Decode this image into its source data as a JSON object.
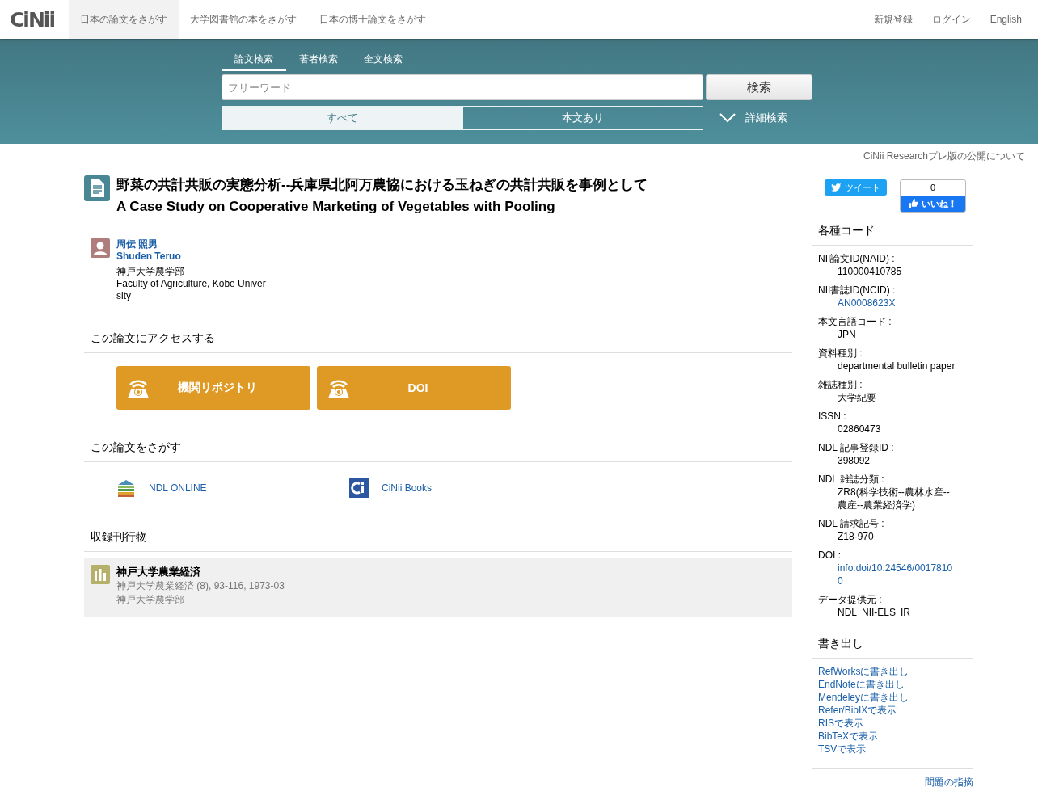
{
  "logo": "CiNii",
  "nav": [
    {
      "label": "日本の論文をさがす",
      "selected": true
    },
    {
      "label": "大学図書館の本をさがす",
      "selected": false
    },
    {
      "label": "日本の博士論文をさがす",
      "selected": false
    }
  ],
  "account_links": [
    "新規登録",
    "ログイン",
    "English"
  ],
  "search": {
    "tabs": [
      {
        "label": "論文検索",
        "selected": true
      },
      {
        "label": "著者検索",
        "selected": false
      },
      {
        "label": "全文検索",
        "selected": false
      }
    ],
    "placeholder": "フリーワード",
    "button": "検索",
    "filters": [
      {
        "label": "すべて",
        "selected": true
      },
      {
        "label": "本文あり",
        "selected": false
      }
    ],
    "advanced": "詳細検索"
  },
  "notice_link": "CiNii Researchプレ版の公開について",
  "article": {
    "title_ja": "野菜の共計共販の実態分析--兵庫県北阿万農協における玉ねぎの共計共販を事例として",
    "title_en": "A Case Study on Cooperative Marketing of Vegetables with Pooling",
    "authors": [
      {
        "name_ja": "周伝 照男",
        "name_en": "Shuden Teruo",
        "affiliation_ja": "神戸大学農学部",
        "affiliation_en": "Faculty of Agriculture, Kobe University"
      }
    ]
  },
  "access": {
    "heading": "この論文にアクセスする",
    "buttons": [
      "機関リポジトリ",
      "DOI"
    ]
  },
  "find": {
    "heading": "この論文をさがす",
    "links": [
      {
        "label": "NDL ONLINE",
        "kind": "ndl"
      },
      {
        "label": "CiNii Books",
        "kind": "cinii"
      }
    ]
  },
  "journal": {
    "heading": "収録刊行物",
    "title": "神戸大学農業経済",
    "citation": "神戸大学農業経済 (8), 93-116, 1973-03",
    "publisher": "神戸大学農学部"
  },
  "social": {
    "tweet": "ツイート",
    "like_count": "0",
    "like": "いいね！"
  },
  "codes": {
    "heading": "各種コード",
    "items": [
      {
        "label": "NII論文ID(NAID) :",
        "value": "110000410785",
        "link": false
      },
      {
        "label": "NII書誌ID(NCID) :",
        "value": "AN0008623X",
        "link": true
      },
      {
        "label": "本文言語コード :",
        "value": "JPN",
        "link": false
      },
      {
        "label": "資料種別 :",
        "value": "departmental bulletin paper",
        "link": false
      },
      {
        "label": "雑誌種別 :",
        "value": "大学紀要",
        "link": false
      },
      {
        "label": "ISSN :",
        "value": "02860473",
        "link": false
      },
      {
        "label": "NDL 記事登録ID :",
        "value": "398092",
        "link": false
      },
      {
        "label": "NDL 雑誌分類 :",
        "value": "ZR8(科学技術--農林水産--農産--農業経済学)",
        "link": false
      },
      {
        "label": "NDL 請求記号 :",
        "value": "Z18-970",
        "link": false
      },
      {
        "label": "DOI :",
        "value": "info:doi/10.24546/00178100",
        "link": true
      }
    ],
    "providers_label": "データ提供元 :",
    "providers": [
      "NDL",
      "NII-ELS",
      "IR"
    ]
  },
  "export": {
    "heading": "書き出し",
    "links": [
      "RefWorksに書き出し",
      "EndNoteに書き出し",
      "Mendeleyに書き出し",
      "Refer/BibIXで表示",
      "RISで表示",
      "BibTeXで表示",
      "TSVで表示"
    ]
  },
  "report_link": "問題の指摘"
}
